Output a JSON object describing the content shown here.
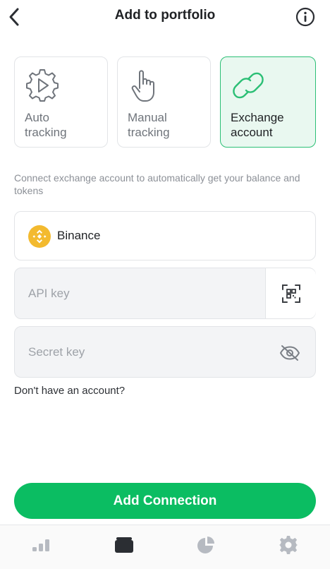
{
  "header": {
    "title": "Add to portfolio",
    "back_icon": "chevron-left-icon",
    "info_icon": "info-circle-icon"
  },
  "tabs": [
    {
      "id": "auto",
      "label": "Auto\ntracking",
      "icon": "gear-play-icon",
      "selected": false
    },
    {
      "id": "manual",
      "label": "Manual\ntracking",
      "icon": "hand-pointer-icon",
      "selected": false
    },
    {
      "id": "exchange",
      "label": "Exchange\naccount",
      "icon": "link-icon",
      "selected": true
    }
  ],
  "description": "Connect exchange account to automatically get your balance and tokens",
  "exchange": {
    "name": "Binance",
    "logo": "binance-logo"
  },
  "api_key": {
    "placeholder": "API key",
    "value": "",
    "action_icon": "qr-scan-icon"
  },
  "secret_key": {
    "placeholder": "Secret key",
    "value": "",
    "action_icon": "eye-off-icon"
  },
  "no_account_link": "Don't have an account?",
  "add_button": "Add Connection",
  "bottom_nav": [
    {
      "id": "markets",
      "icon": "bar-chart-icon",
      "active": false
    },
    {
      "id": "portfolio",
      "icon": "wallet-icon",
      "active": true
    },
    {
      "id": "analytics",
      "icon": "pie-chart-icon",
      "active": false
    },
    {
      "id": "settings",
      "icon": "gear-icon",
      "active": false
    }
  ],
  "colors": {
    "accent": "#0bbd62",
    "selected_border": "#2bbf75",
    "selected_bg": "#e9f8f0",
    "binance": "#f3ba2f",
    "nav_inactive": "#b6bac1",
    "nav_active": "#2b2e33"
  }
}
